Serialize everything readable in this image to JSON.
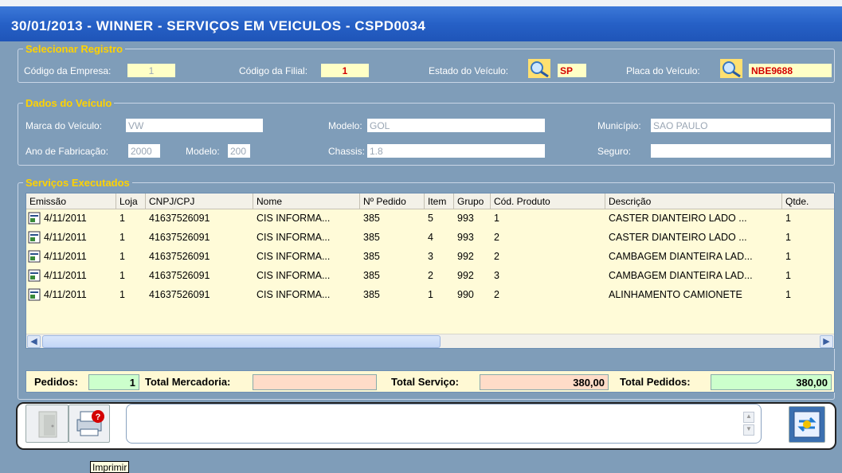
{
  "window": {
    "title": "30/01/2013  -  WINNER  -  SERVIÇOS EM VEICULOS  -  CSPD0034"
  },
  "selecionar": {
    "title": "Selecionar Registro",
    "empresa_label": "Código da Empresa:",
    "empresa_value": "1",
    "filial_label": "Código da Filial:",
    "filial_value": "1",
    "estado_label": "Estado do Veículo:",
    "estado_value": "SP",
    "placa_label": "Placa do Veículo:",
    "placa_value": "NBE9688"
  },
  "veiculo": {
    "title": "Dados do Veículo",
    "marca_label": "Marca do Veículo:",
    "marca_value": "VW",
    "modelo_label": "Modelo:",
    "modelo_value": "GOL",
    "municipio_label": "Município:",
    "municipio_value": "SAO PAULO",
    "ano_label": "Ano de Fabricação:",
    "ano_value": "2000",
    "modelo2_label": "Modelo:",
    "modelo2_value": "200",
    "chassis_label": "Chassis:",
    "chassis_value": "1.8",
    "seguro_label": "Seguro:",
    "seguro_value": ""
  },
  "servicos": {
    "title": "Serviços Executados",
    "columns": [
      "Emissão",
      "Loja",
      "CNPJ/CPJ",
      "Nome",
      "Nº Pedido",
      "Item",
      "Grupo",
      "Cód. Produto",
      "Descrição",
      "Qtde."
    ],
    "rows": [
      [
        "4/11/2011",
        "1",
        "41637526091",
        "CIS INFORMA...",
        "385",
        "5",
        "993",
        "1",
        "CASTER DIANTEIRO LADO ...",
        "1"
      ],
      [
        "4/11/2011",
        "1",
        "41637526091",
        "CIS INFORMA...",
        "385",
        "4",
        "993",
        "2",
        "CASTER DIANTEIRO LADO ...",
        "1"
      ],
      [
        "4/11/2011",
        "1",
        "41637526091",
        "CIS INFORMA...",
        "385",
        "3",
        "992",
        "2",
        "CAMBAGEM DIANTEIRA LAD...",
        "1"
      ],
      [
        "4/11/2011",
        "1",
        "41637526091",
        "CIS INFORMA...",
        "385",
        "2",
        "992",
        "3",
        "CAMBAGEM DIANTEIRA LAD...",
        "1"
      ],
      [
        "4/11/2011",
        "1",
        "41637526091",
        "CIS INFORMA...",
        "385",
        "1",
        "990",
        "2",
        "ALINHAMENTO CAMIONETE",
        "1"
      ]
    ]
  },
  "totais": {
    "pedidos_label": "Pedidos:",
    "pedidos_value": "1",
    "mercadoria_label": "Total Mercadoria:",
    "mercadoria_value": "",
    "servico_label": "Total Serviço:",
    "servico_value": "380,00",
    "totalped_label": "Total Pedidos:",
    "totalped_value": "380,00"
  },
  "toolbar": {
    "tooltip": "Imprimir",
    "message": ""
  },
  "colors": {
    "accent_yellow": "#ffd200",
    "title_blue": "#2660c6",
    "panel_blue": "#7f9db9",
    "green_field": "#ccffcc",
    "peach_field": "#ffdcc8"
  }
}
